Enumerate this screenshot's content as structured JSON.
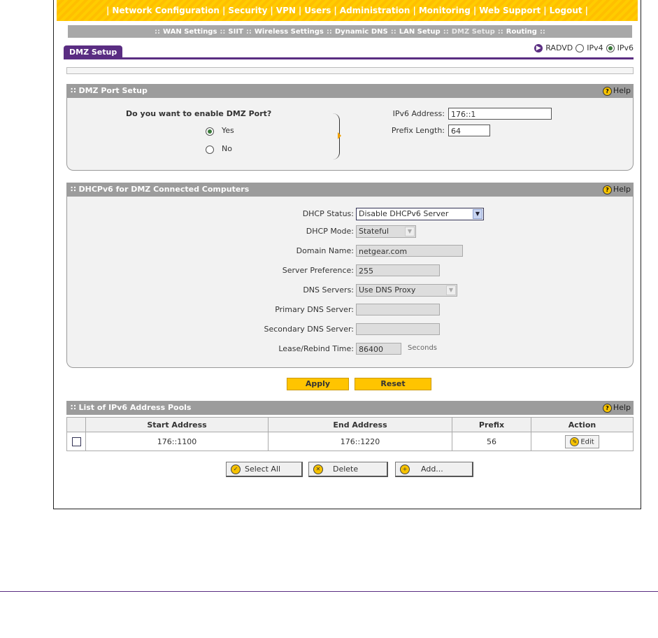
{
  "top_nav": [
    "Network Configuration",
    "Security",
    "VPN",
    "Users",
    "Administration",
    "Monitoring",
    "Web Support",
    "Logout"
  ],
  "sub_nav": [
    "WAN Settings",
    "SIIT",
    "Wireless Settings",
    "Dynamic DNS",
    "LAN Setup",
    "DMZ Setup",
    "Routing"
  ],
  "tab": {
    "label": "DMZ Setup"
  },
  "views": {
    "radvd": "RADVD",
    "ipv4": "IPv4",
    "ipv6": "IPv6",
    "selected": "IPv6"
  },
  "dmz_port": {
    "title": "DMZ Port Setup",
    "help": "Help",
    "question": "Do you want to enable DMZ Port?",
    "yes": "Yes",
    "no": "No",
    "selected": "Yes",
    "ipv6_label": "IPv6 Address:",
    "ipv6_value": "176::1",
    "prefix_label": "Prefix Length:",
    "prefix_value": "64"
  },
  "dhcp": {
    "title": "DHCPv6 for DMZ Connected Computers",
    "help": "Help",
    "status_label": "DHCP Status:",
    "status_value": "Disable DHCPv6 Server",
    "mode_label": "DHCP Mode:",
    "mode_value": "Stateful",
    "domain_label": "Domain Name:",
    "domain_value": "netgear.com",
    "pref_label": "Server Preference:",
    "pref_value": "255",
    "dns_label": "DNS Servers:",
    "dns_value": "Use DNS Proxy",
    "primary_label": "Primary DNS Server:",
    "primary_value": "",
    "secondary_label": "Secondary DNS Server:",
    "secondary_value": "",
    "lease_label": "Lease/Rebind Time:",
    "lease_value": "86400",
    "lease_unit": "Seconds"
  },
  "buttons": {
    "apply": "Apply",
    "reset": "Reset"
  },
  "pools": {
    "title": "List of IPv6 Address Pools",
    "help": "Help",
    "columns": [
      "Start Address",
      "End Address",
      "Prefix",
      "Action"
    ],
    "rows": [
      {
        "start": "176::1100",
        "end": "176::1220",
        "prefix": "56",
        "action": "Edit"
      }
    ],
    "select_all": "Select All",
    "delete": "Delete",
    "add": "Add..."
  }
}
